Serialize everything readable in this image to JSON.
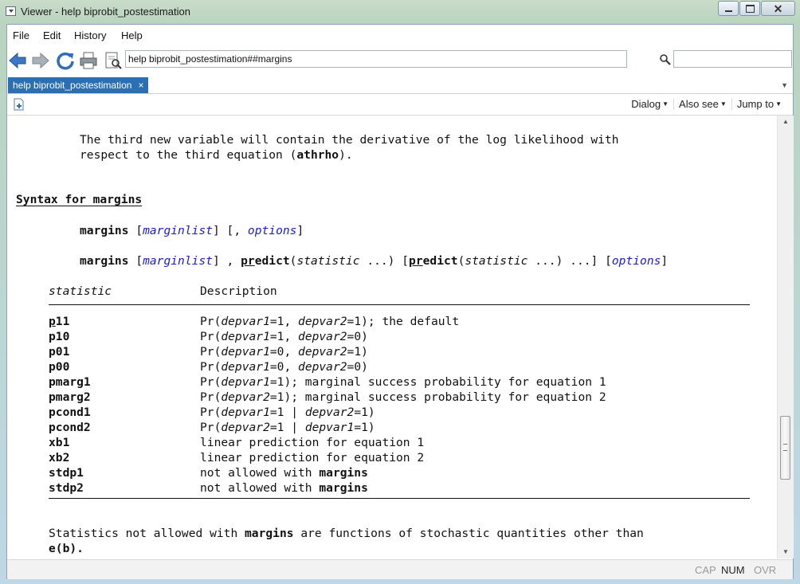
{
  "window": {
    "title": "Viewer - help biprobit_postestimation"
  },
  "menu": [
    "File",
    "Edit",
    "History",
    "Help"
  ],
  "toolbar": {
    "address": "help biprobit_postestimation##margins",
    "search_value": ""
  },
  "tab": {
    "label": "help biprobit_postestimation",
    "close": "×"
  },
  "tools": {
    "dialog": "Dialog",
    "also_see": "Also see",
    "jump_to": "Jump to"
  },
  "doc": {
    "intro1": "The third new variable will contain the derivative of the log likelihood with",
    "intro2_pre": "respect to the third equation (",
    "intro2_bold": "athrho",
    "intro2_post": ").",
    "heading": "Syntax for margins",
    "cmd": "margins",
    "lb": "[",
    "rb": "]",
    "marginlist": "marginlist",
    "comma_open": "] [, ",
    "options": "options",
    "comma": "] , ",
    "pr": "pr",
    "edict": "edict",
    "open_paren": "(",
    "statistic": "statistic",
    "dots_close": " ...)",
    "between": " [",
    "tail": " ...] [",
    "col_statistic": "statistic",
    "col_description": "Description",
    "rows": [
      {
        "u": "p",
        "r": "11",
        "parts": [
          [
            "Pr(",
            ""
          ],
          [
            "depvar1",
            "it"
          ],
          [
            "=1, ",
            ""
          ],
          [
            "depvar2",
            "it"
          ],
          [
            "=1); the default",
            ""
          ]
        ]
      },
      {
        "u": "",
        "r": "p10",
        "parts": [
          [
            "Pr(",
            ""
          ],
          [
            "depvar1",
            "it"
          ],
          [
            "=1, ",
            ""
          ],
          [
            "depvar2",
            "it"
          ],
          [
            "=0)",
            ""
          ]
        ]
      },
      {
        "u": "",
        "r": "p01",
        "parts": [
          [
            "Pr(",
            ""
          ],
          [
            "depvar1",
            "it"
          ],
          [
            "=0, ",
            ""
          ],
          [
            "depvar2",
            "it"
          ],
          [
            "=1)",
            ""
          ]
        ]
      },
      {
        "u": "",
        "r": "p00",
        "parts": [
          [
            "Pr(",
            ""
          ],
          [
            "depvar1",
            "it"
          ],
          [
            "=0, ",
            ""
          ],
          [
            "depvar2",
            "it"
          ],
          [
            "=0)",
            ""
          ]
        ]
      },
      {
        "u": "",
        "r": "pmarg1",
        "parts": [
          [
            "Pr(",
            ""
          ],
          [
            "depvar1",
            "it"
          ],
          [
            "=1); marginal success probability for equation 1",
            ""
          ]
        ]
      },
      {
        "u": "",
        "r": "pmarg2",
        "parts": [
          [
            "Pr(",
            ""
          ],
          [
            "depvar2",
            "it"
          ],
          [
            "=1); marginal success probability for equation 2",
            ""
          ]
        ]
      },
      {
        "u": "",
        "r": "pcond1",
        "parts": [
          [
            "Pr(",
            ""
          ],
          [
            "depvar1",
            "it"
          ],
          [
            "=1 | ",
            ""
          ],
          [
            "depvar2",
            "it"
          ],
          [
            "=1)",
            ""
          ]
        ]
      },
      {
        "u": "",
        "r": "pcond2",
        "parts": [
          [
            "Pr(",
            ""
          ],
          [
            "depvar2",
            "it"
          ],
          [
            "=1 | ",
            ""
          ],
          [
            "depvar1",
            "it"
          ],
          [
            "=1)",
            ""
          ]
        ]
      },
      {
        "u": "",
        "r": "xb1",
        "parts": [
          [
            "linear prediction for equation 1",
            ""
          ]
        ]
      },
      {
        "u": "",
        "r": "xb2",
        "parts": [
          [
            "linear prediction for equation 2",
            ""
          ]
        ]
      },
      {
        "u": "",
        "r": "stdp1",
        "parts": [
          [
            "not allowed with ",
            ""
          ],
          [
            "margins",
            "bold"
          ]
        ]
      },
      {
        "u": "",
        "r": "stdp2",
        "parts": [
          [
            "not allowed with ",
            ""
          ],
          [
            "margins",
            "bold"
          ]
        ]
      }
    ],
    "outro1_pre": "Statistics not allowed with ",
    "outro1_bold": "margins",
    "outro1_post": " are functions of stochastic quantities other than",
    "outro2": "e(b)."
  },
  "status": {
    "cap": "CAP",
    "num": "NUM",
    "ovr": "OVR"
  }
}
